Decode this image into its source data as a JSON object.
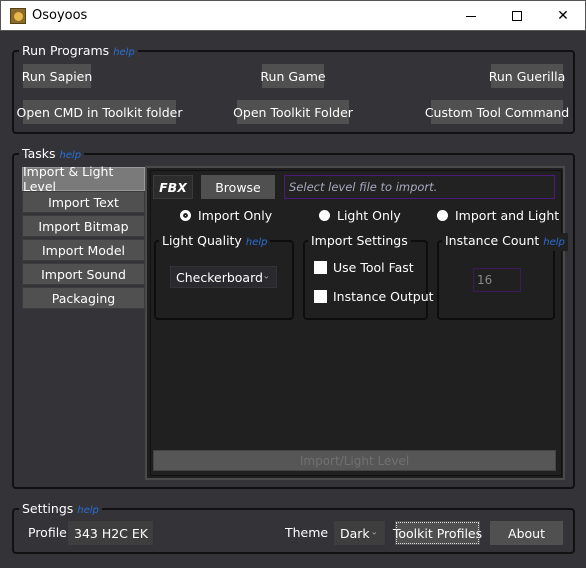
{
  "window": {
    "title": "Osoyoos",
    "minimize_label": "",
    "close_glyph": "✕"
  },
  "run_programs": {
    "label": "Run Programs",
    "help": "help",
    "buttons": {
      "run_sapien": "Run Sapien",
      "run_game": "Run Game",
      "run_guerilla": "Run Guerilla",
      "open_cmd": "Open CMD in Toolkit folder",
      "open_toolkit_folder": "Open Toolkit Folder",
      "custom_tool_command": "Custom Tool Command"
    }
  },
  "tasks": {
    "label": "Tasks",
    "help": "help",
    "tabs": [
      {
        "label": "Import & Light Level",
        "active": true
      },
      {
        "label": "Import Text",
        "active": false
      },
      {
        "label": "Import Bitmap",
        "active": false
      },
      {
        "label": "Import Model",
        "active": false
      },
      {
        "label": "Import Sound",
        "active": false
      },
      {
        "label": "Packaging",
        "active": false
      }
    ],
    "panel": {
      "fbx_label": "FBX",
      "browse_label": "Browse",
      "path_placeholder": "Select level file to import.",
      "radios": [
        {
          "label": "Import Only",
          "checked": true
        },
        {
          "label": "Light Only",
          "checked": false
        },
        {
          "label": "Import and Light",
          "checked": false
        }
      ],
      "light_quality": {
        "label": "Light Quality",
        "help": "help",
        "selected": "Checkerboard"
      },
      "import_settings": {
        "label": "Import Settings",
        "checkboxes": [
          {
            "label": "Use Tool Fast",
            "checked": false
          },
          {
            "label": "Instance Output",
            "checked": false
          }
        ]
      },
      "instance_count": {
        "label": "Instance Count",
        "help": "help",
        "value": "16"
      },
      "run_label": "Import/Light Level"
    }
  },
  "settings": {
    "label": "Settings",
    "help": "help",
    "profile_label": "Profile",
    "profile_selected": "343 H2C EK",
    "theme_label": "Theme",
    "theme_selected": "Dark",
    "toolkit_profiles_label": "Toolkit Profiles",
    "about_label": "About"
  },
  "icons": {
    "chevron": "⌄"
  }
}
